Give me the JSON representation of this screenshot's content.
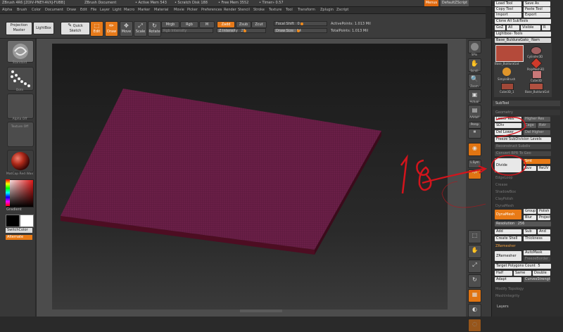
{
  "title_bar": {
    "app": "ZBrush 4R6 [ZOIV-PNEY-AVXJ-FUBB]",
    "document": "ZBrush Document",
    "active_mem": "• Active Mem 543",
    "scratch_disk": "• Scratch Disk 188",
    "free_mem": "• Free Mem 3552",
    "timer": "• Timer» 0.57"
  },
  "menu": {
    "items": [
      "Alpha",
      "Brush",
      "Color",
      "Document",
      "Draw",
      "Edit",
      "File",
      "Layer",
      "Light",
      "Macro",
      "Marker",
      "Material",
      "Movie",
      "Picker",
      "Preferences",
      "Render",
      "Stencil",
      "Stroke",
      "Texture",
      "Tool",
      "Transform",
      "Zplugin",
      "Zscript"
    ],
    "menus_button": "Menus",
    "default_zscript": "DefaultZScript"
  },
  "toolbar": {
    "projection_master": "Projection Master",
    "lightbox": "LightBox",
    "quick_sketch": "Quick Sketch",
    "edit": "Edit",
    "draw": "Draw",
    "move": "Move",
    "scale": "Scale",
    "rotate": "Rotate",
    "mrgb": "Mrgb",
    "rgb": "Rgb",
    "m": "M",
    "zadd": "Zadd",
    "zsub": "Zsub",
    "zcut": "Zcut",
    "rgb_intensity": "Rgb Intensity",
    "z_intensity": "Z Intensity",
    "z_intensity_value": "25",
    "focal_shift": "Focal Shift",
    "focal_shift_value": "0",
    "draw_size": "Draw Size",
    "draw_size_value": "64",
    "active_points": "ActivePoints: 1.013 Mil",
    "total_points": "TotalPoints: 1.013 Mil"
  },
  "left_shelf": {
    "brush_label": "Standard",
    "stroke_label": "Dots",
    "alpha_label": "Alpha Off",
    "texture_label": "Texture Off",
    "material_label": "MatCap Red Wax",
    "gradient_label": "Gradient",
    "switch_color": "SwitchColor",
    "alternate": "Alternate"
  },
  "right_shelf": {
    "labels": [
      "BPR",
      "SPix",
      "Scroll",
      "Zoom",
      "Actual",
      "AAHalf",
      "Persp",
      "Floor",
      "Local",
      "L.Sym",
      "Xyz",
      "Frame",
      "Move",
      "Scale",
      "Rotate",
      "Line Fill PolyF",
      "Transp",
      "Ghost"
    ],
    "spix_value": "3"
  },
  "palette": {
    "top_buttons": [
      "Load Tool",
      "Save As",
      "Copy Tool",
      "Paste Tool",
      "Import",
      "Export"
    ],
    "clone": "Clone",
    "make_polymesh": "Make PolyMesh3D",
    "clone_all": "Clone All SubTools",
    "goz": "GoZ",
    "all": "All",
    "visible": "Visible",
    "r": "R",
    "lightbox_tools": "Lightbox› Tools",
    "current_tool": "Base_BulduraGato_ Nam",
    "tool_thumbs": [
      "Base_BulduraGat",
      "Cylinder3D",
      "PolyMesh3D",
      "SimpleBrush",
      "Cube3D",
      "Cube3D_1",
      "Base_BulduraGat"
    ],
    "subtool": "SubTool",
    "geometry": "Geometry",
    "lower_res": "Lower Res",
    "higher_res": "Higher Res",
    "sdiv": "SDiv",
    "cage": "Cage",
    "rstr": "Rstr",
    "del_lower": "Del Lower",
    "del_higher": "Del Higher",
    "freeze_subdivision": "Freeze SubDivision Levels",
    "reconstruct_subdiv": "Reconstruct Subdiv",
    "convert_bpr": "Convert BPR To Geo",
    "divide": "Divide",
    "smt": "Smt",
    "suv": "Suv",
    "reuv": "ReUV",
    "edgeloop": "EdgeLoop",
    "crease": "Crease",
    "shadowbox": "ShadowBox",
    "claypolish": "ClayPolish",
    "dynamesh_section": "DynaMesh",
    "dynamesh": "DynaMesh",
    "group": "Group",
    "polish": "Polish",
    "blur": "Blur",
    "project": "Project",
    "resolution": "Resolution",
    "resolution_value": "256",
    "add": "Add",
    "sub": "Sub",
    "and": "And",
    "create_shell": "Create Shell",
    "thickness": "Thickness",
    "zremesher_section": "ZRemesher",
    "zremesher": "ZRemesher",
    "automask": "AutoMask",
    "freeze_border": "FreezeBorder",
    "target_polygons": "Target Polygons Count",
    "target_polygons_value": "5",
    "half": "Half",
    "same": "Same",
    "double": "Double",
    "adapt": "Adapt",
    "curves_strength": "CurvesStrength",
    "modify_topology": "Modify Topology",
    "meshintegrity": "MeshIntegrity",
    "layers": "Layers"
  },
  "annotation": {
    "text": "18",
    "color": "#d4141c"
  },
  "colors": {
    "accent": "#e87a16",
    "mesh": "#6a1f47"
  }
}
